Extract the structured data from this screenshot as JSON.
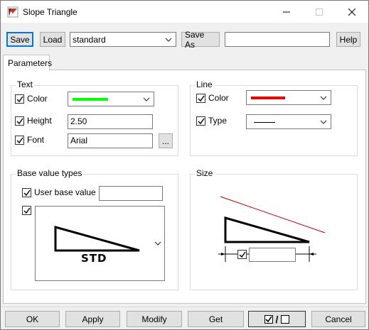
{
  "window": {
    "title": "Slope Triangle",
    "minimize_icon": "minimize-icon",
    "maximize_icon": "maximize-icon",
    "close_icon": "close-icon"
  },
  "toolbar": {
    "save_label": "Save",
    "load_label": "Load",
    "preset_value": "standard",
    "save_as_label": "Save As",
    "save_as_value": "",
    "help_label": "Help"
  },
  "tabs": [
    {
      "label": "Parameters",
      "selected": true
    }
  ],
  "text_group": {
    "title": "Text",
    "color_label": "Color",
    "color_checked": true,
    "color_value": "#00ff00",
    "height_label": "Height",
    "height_checked": true,
    "height_value": "2.50",
    "font_label": "Font",
    "font_checked": true,
    "font_value": "Arial",
    "browse_label": "..."
  },
  "line_group": {
    "title": "Line",
    "color_label": "Color",
    "color_checked": true,
    "color_value": "#e00000",
    "type_label": "Type",
    "type_checked": true
  },
  "base_group": {
    "title": "Base value types",
    "user_base_label": "User base value",
    "user_base_checked": true,
    "user_base_value": "",
    "type_checked": true,
    "preview_text": "STD"
  },
  "size_group": {
    "title": "Size",
    "size_checked": true,
    "size_value": ""
  },
  "bottom": {
    "ok_label": "OK",
    "apply_label": "Apply",
    "modify_label": "Modify",
    "get_label": "Get",
    "toggle_label": "/",
    "cancel_label": "Cancel"
  }
}
